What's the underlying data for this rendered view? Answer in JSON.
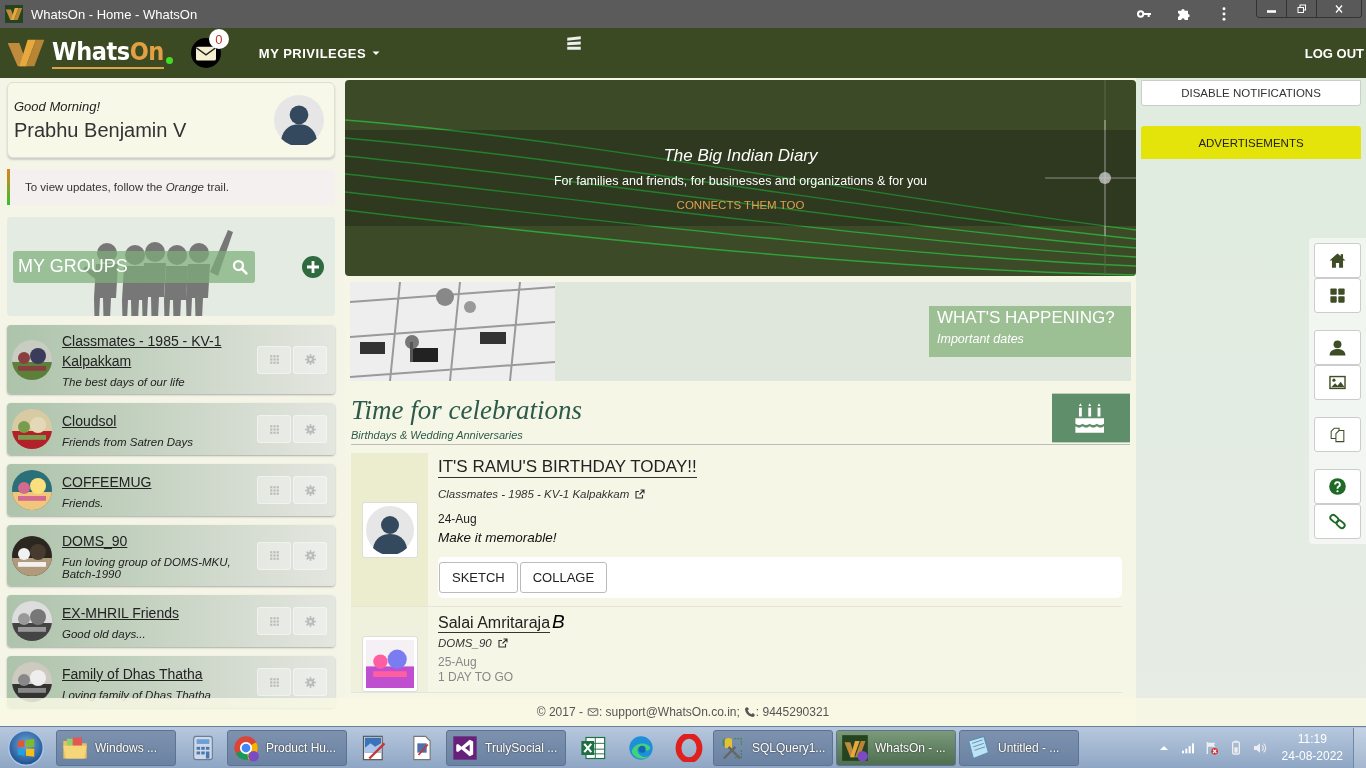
{
  "window": {
    "title": "WhatsOn - Home - WhatsOn"
  },
  "navbar": {
    "brand_first": "Whats",
    "brand_second": "On",
    "message_count": "0",
    "menu": "MY PRIVILEGES",
    "logout": "LOG OUT"
  },
  "greeting": {
    "salutation": "Good Morning!",
    "name": "Prabhu Benjamin V"
  },
  "tip": "To view updates, follow the *Orange* trail.",
  "groups": {
    "title": "MY GROUPS",
    "items": [
      {
        "name": "Classmates - 1985 - KV-1 Kalpakkam",
        "description": "The best days of our life"
      },
      {
        "name": "Cloudsol",
        "description": "Friends from Satren Days"
      },
      {
        "name": "COFFEEMUG",
        "description": "Friends."
      },
      {
        "name": "DOMS_90",
        "description": "Fun loving group of DOMS-MKU, Batch-1990"
      },
      {
        "name": "EX-MHRIL Friends",
        "description": "Good old days..."
      },
      {
        "name": "Family of Dhas Thatha",
        "description": "Loving family of Dhas Thatha"
      }
    ]
  },
  "banner": {
    "title": "The Big Indian Diary",
    "subtitle": "For families and friends, for businesses and organizations & for you",
    "tagline": "CONNECTS THEM TOO"
  },
  "happening": {
    "title": "WHAT'S HAPPENING?",
    "subtitle": "Important dates"
  },
  "celebrations": {
    "title": "Time for celebrations",
    "subtitle": "Birthdays & Wedding Anniversaries",
    "events": [
      {
        "kind": "today",
        "title": "IT'S RAMU'S BIRTHDAY TODAY!!",
        "group": "Classmates - 1985 - KV-1 Kalpakkam",
        "date": "24-Aug",
        "message": "Make it memorable!",
        "buttons": [
          "SKETCH",
          "COLLAGE"
        ]
      },
      {
        "kind": "upcoming",
        "title": "Salai Amritaraja",
        "title_suffix": "B",
        "group": "DOMS_90",
        "date": "25-Aug",
        "message": "1 DAY TO GO"
      }
    ]
  },
  "sidebar": {
    "notifications_button": "DISABLE NOTIFICATIONS",
    "advertisements": "ADVERTISEMENTS"
  },
  "footer": {
    "copyright": "© 2017 -",
    "email": ": support@WhatsOn.co.in;",
    "phone": ": 9445290321"
  },
  "taskbar": {
    "items": [
      {
        "kind": "folder",
        "label": "Windows ...",
        "selected": false
      },
      {
        "kind": "calculator",
        "selected": false
      },
      {
        "kind": "browser",
        "label": "Product Hu...",
        "selected": false
      },
      {
        "kind": "paint",
        "selected": false
      },
      {
        "kind": "document",
        "selected": false
      },
      {
        "kind": "studio",
        "label": "TrulySocial ...",
        "selected": false
      },
      {
        "kind": "spreadsheet",
        "selected": false
      },
      {
        "kind": "wave",
        "selected": false
      },
      {
        "kind": "ring",
        "selected": false
      },
      {
        "kind": "database",
        "label": "SQLQuery1...",
        "selected": false
      },
      {
        "kind": "logo",
        "label": "WhatsOn - ...",
        "selected": true
      },
      {
        "kind": "notepad",
        "label": "Untitled - ...",
        "selected": false
      }
    ],
    "clock_time": "11:19",
    "clock_date": "24-08-2022"
  }
}
